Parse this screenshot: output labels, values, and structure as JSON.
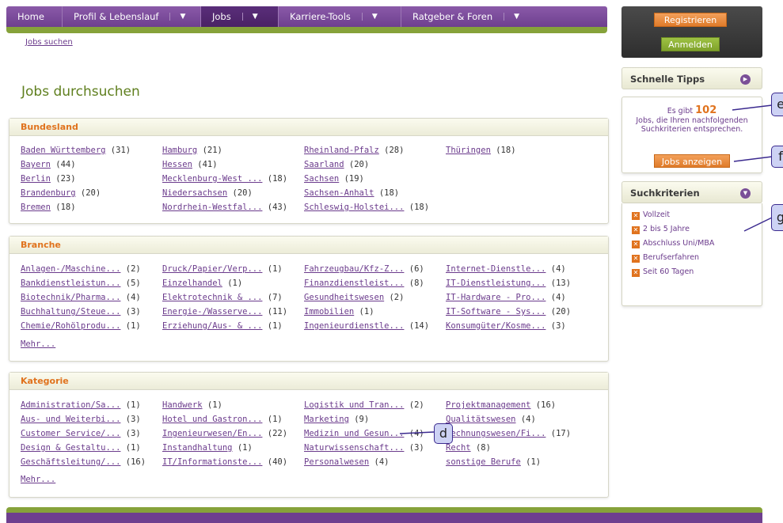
{
  "nav": {
    "items": [
      {
        "label": "Home",
        "dropdown": false,
        "active": false
      },
      {
        "label": "Profil & Lebenslauf",
        "dropdown": true,
        "active": false
      },
      {
        "label": "Jobs",
        "dropdown": true,
        "active": true
      },
      {
        "label": "Karriere-Tools",
        "dropdown": true,
        "active": false
      },
      {
        "label": "Ratgeber & Foren",
        "dropdown": true,
        "active": false
      }
    ],
    "dropdown_glyph": "▼"
  },
  "breadcrumb": "Jobs suchen",
  "page_title": "Jobs durchsuchen",
  "sections": {
    "bundesland": {
      "title": "Bundesland",
      "columns": [
        [
          {
            "label": "Baden Württemberg",
            "count": "(31)"
          },
          {
            "label": "Bayern",
            "count": "(44)"
          },
          {
            "label": "Berlin",
            "count": "(23)"
          },
          {
            "label": "Brandenburg",
            "count": "(20)"
          },
          {
            "label": "Bremen",
            "count": "(18)"
          }
        ],
        [
          {
            "label": "Hamburg",
            "count": "(21)"
          },
          {
            "label": "Hessen",
            "count": "(41)"
          },
          {
            "label": "Mecklenburg-West ...",
            "count": "(18)"
          },
          {
            "label": "Niedersachsen",
            "count": "(20)"
          },
          {
            "label": "Nordrhein-Westfal...",
            "count": "(43)"
          }
        ],
        [
          {
            "label": "Rheinland-Pfalz",
            "count": "(28)"
          },
          {
            "label": "Saarland",
            "count": "(20)"
          },
          {
            "label": "Sachsen",
            "count": "(19)"
          },
          {
            "label": "Sachsen-Anhalt",
            "count": "(18)"
          },
          {
            "label": "Schleswig-Holstei...",
            "count": "(18)"
          }
        ],
        [
          {
            "label": "Thüringen",
            "count": "(18)"
          }
        ]
      ]
    },
    "branche": {
      "title": "Branche",
      "more": "Mehr...",
      "columns": [
        [
          {
            "label": "Anlagen-/Maschine...",
            "count": "(2)"
          },
          {
            "label": "Bankdienstleistun...",
            "count": "(5)"
          },
          {
            "label": "Biotechnik/Pharma...",
            "count": "(4)"
          },
          {
            "label": "Buchhaltung/Steue...",
            "count": "(3)"
          },
          {
            "label": "Chemie/Rohölprodu...",
            "count": "(1)"
          }
        ],
        [
          {
            "label": "Druck/Papier/Verp...",
            "count": "(1)"
          },
          {
            "label": "Einzelhandel",
            "count": "(1)"
          },
          {
            "label": "Elektrotechnik & ...",
            "count": "(7)"
          },
          {
            "label": "Energie-/Wasserve...",
            "count": "(11)"
          },
          {
            "label": "Erziehung/Aus- & ...",
            "count": "(1)"
          }
        ],
        [
          {
            "label": "Fahrzeugbau/Kfz-Z...",
            "count": "(6)"
          },
          {
            "label": "Finanzdienstleist...",
            "count": "(8)"
          },
          {
            "label": "Gesundheitswesen",
            "count": "(2)"
          },
          {
            "label": "Immobilien",
            "count": "(1)"
          },
          {
            "label": "Ingenieurdienstle...",
            "count": "(14)"
          }
        ],
        [
          {
            "label": "Internet-Dienstle...",
            "count": "(4)"
          },
          {
            "label": "IT-Dienstleistung...",
            "count": "(13)"
          },
          {
            "label": "IT-Hardware - Pro...",
            "count": "(4)"
          },
          {
            "label": "IT-Software - Sys...",
            "count": "(20)"
          },
          {
            "label": "Konsumgüter/Kosme...",
            "count": "(3)"
          }
        ]
      ]
    },
    "kategorie": {
      "title": "Kategorie",
      "more": "Mehr...",
      "columns": [
        [
          {
            "label": "Administration/Sa...",
            "count": "(1)"
          },
          {
            "label": "Aus- und Weiterbi...",
            "count": "(3)"
          },
          {
            "label": "Customer Service/...",
            "count": "(3)"
          },
          {
            "label": "Design & Gestaltu...",
            "count": "(1)"
          },
          {
            "label": "Geschäftsleitung/...",
            "count": "(16)"
          }
        ],
        [
          {
            "label": "Handwerk",
            "count": "(1)"
          },
          {
            "label": "Hotel und Gastron...",
            "count": "(1)"
          },
          {
            "label": "Ingenieurwesen/En...",
            "count": "(22)"
          },
          {
            "label": "Instandhaltung",
            "count": "(1)"
          },
          {
            "label": "IT/Informationste...",
            "count": "(40)"
          }
        ],
        [
          {
            "label": "Logistik und Tran...",
            "count": "(2)"
          },
          {
            "label": "Marketing",
            "count": "(9)"
          },
          {
            "label": "Medizin und Gesun...",
            "count": "(4)"
          },
          {
            "label": "Naturwissenschaft...",
            "count": "(3)"
          },
          {
            "label": "Personalwesen",
            "count": "(4)"
          }
        ],
        [
          {
            "label": "Projektmanagement",
            "count": "(16)"
          },
          {
            "label": "Qualitätswesen",
            "count": "(4)"
          },
          {
            "label": "Rechnungswesen/Fi...",
            "count": "(17)"
          },
          {
            "label": "Recht",
            "count": "(8)"
          },
          {
            "label": "sonstige Berufe",
            "count": "(1)"
          }
        ]
      ]
    }
  },
  "sidebar": {
    "register": "Registrieren",
    "login": "Anmelden",
    "tips_title": "Schnelle Tipps",
    "tips_line1": "Es gibt",
    "tips_count": "102",
    "tips_line2": "Jobs, die Ihren nachfolgenden Suchkriterien entsprechen.",
    "show_jobs": "Jobs anzeigen",
    "criteria_title": "Suchkriterien",
    "criteria": [
      "Vollzeit",
      "2 bis 5 Jahre",
      "Abschluss Uni/MBA",
      "Berufserfahren",
      "Seit 60 Tagen"
    ]
  },
  "annotations": {
    "d": "d",
    "e": "e",
    "f": "f",
    "g": "g"
  },
  "colors": {
    "brand_purple": "#6e3f8f",
    "accent_orange": "#e0731e",
    "accent_green": "#86a23a",
    "link": "#6b3b8c"
  }
}
